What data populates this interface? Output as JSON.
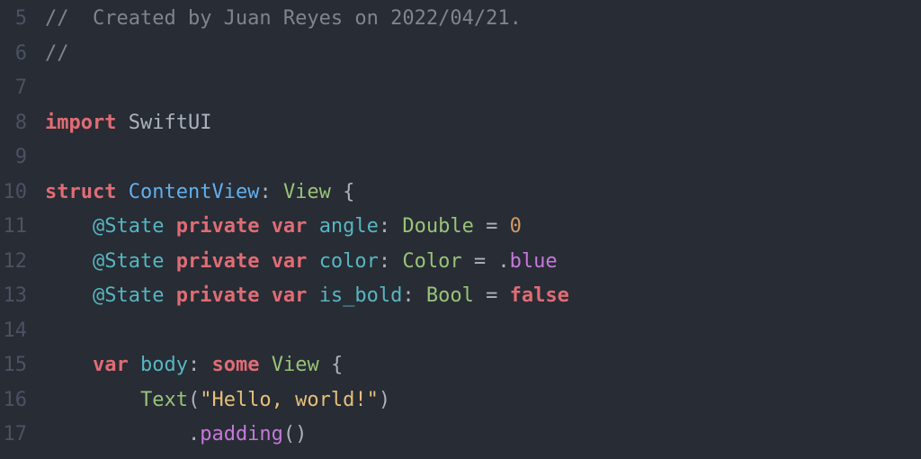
{
  "lines": {
    "start": 5,
    "count": 13,
    "numbers": [
      "5",
      "6",
      "7",
      "8",
      "9",
      "10",
      "11",
      "12",
      "13",
      "14",
      "15",
      "16",
      "17"
    ]
  },
  "l5": {
    "prefix": "//  ",
    "text": "Created by Juan Reyes on 2022/04/21."
  },
  "l6": {
    "prefix": "//"
  },
  "l8": {
    "kw_import": "import",
    "module": "SwiftUI"
  },
  "l10": {
    "kw_struct": "struct",
    "name": "ContentView",
    "colon": ":",
    "proto": "View",
    "brace": "{"
  },
  "l11": {
    "attr": "@State",
    "kw_private": "private",
    "kw_var": "var",
    "name": "angle",
    "colon": ":",
    "type": "Double",
    "eq": "=",
    "value": "0"
  },
  "l12": {
    "attr": "@State",
    "kw_private": "private",
    "kw_var": "var",
    "name": "color",
    "colon": ":",
    "type": "Color",
    "eq": "=",
    "dot": ".",
    "value": "blue"
  },
  "l13": {
    "attr": "@State",
    "kw_private": "private",
    "kw_var": "var",
    "name": "is_bold",
    "colon": ":",
    "type": "Bool",
    "eq": "=",
    "value": "false"
  },
  "l15": {
    "kw_var": "var",
    "name": "body",
    "colon": ":",
    "kw_some": "some",
    "type": "View",
    "brace": "{"
  },
  "l16": {
    "fn": "Text",
    "paren_open": "(",
    "string": "\"Hello, world!\"",
    "paren_close": ")"
  },
  "l17": {
    "dot": ".",
    "method": "padding",
    "parens": "()"
  }
}
